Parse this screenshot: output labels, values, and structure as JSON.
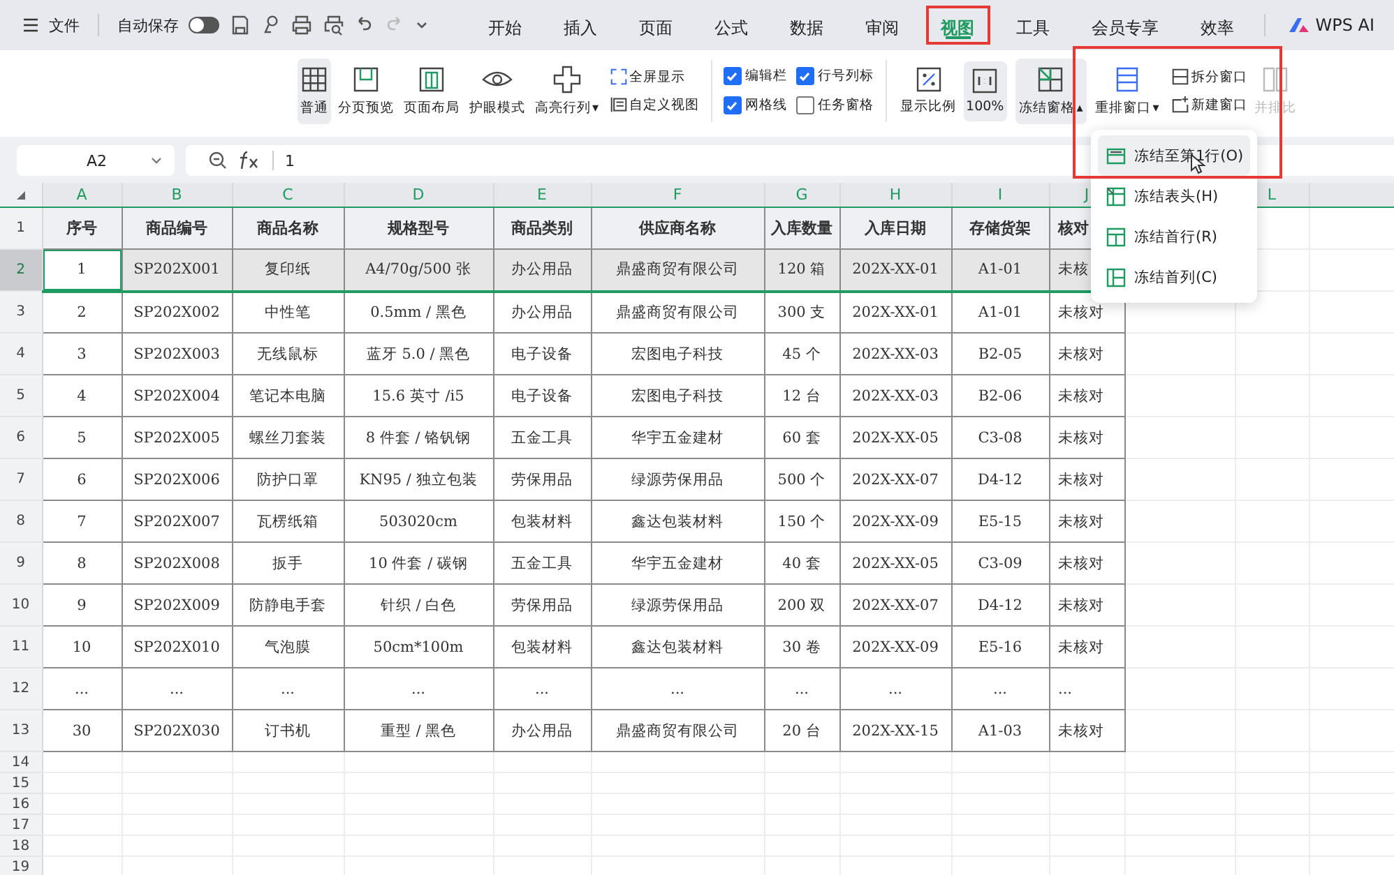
{
  "title_bar": {
    "menu_label": "文件",
    "autosave_label": "自动保存",
    "autosave_on": false
  },
  "tabs": [
    {
      "label": "开始",
      "selected": false,
      "outlined": false
    },
    {
      "label": "插入",
      "selected": false,
      "outlined": false
    },
    {
      "label": "页面",
      "selected": false,
      "outlined": false
    },
    {
      "label": "公式",
      "selected": false,
      "outlined": false
    },
    {
      "label": "数据",
      "selected": false,
      "outlined": false
    },
    {
      "label": "审阅",
      "selected": false,
      "outlined": false
    },
    {
      "label": "视图",
      "selected": true,
      "outlined": true
    },
    {
      "label": "工具",
      "selected": false,
      "outlined": false
    },
    {
      "label": "会员专享",
      "selected": false,
      "outlined": false
    },
    {
      "label": "效率",
      "selected": false,
      "outlined": false
    }
  ],
  "ai_label": "WPS AI",
  "ribbon": {
    "view_buttons": [
      {
        "label": "普通",
        "kind": "grid",
        "selected": true
      },
      {
        "label": "分页预览",
        "kind": "pagebreak",
        "selected": false
      },
      {
        "label": "页面布局",
        "kind": "layout",
        "selected": false
      },
      {
        "label": "护眼模式",
        "kind": "eye",
        "selected": false
      },
      {
        "label": "高亮行列",
        "kind": "cross",
        "selected": false,
        "caret": "▾"
      }
    ],
    "small_buttons": [
      {
        "label": "全屏显示",
        "kind": "fullscreen"
      },
      {
        "label": "自定义视图",
        "kind": "custom"
      }
    ],
    "checkboxes": [
      {
        "label": "编辑栏",
        "checked": true
      },
      {
        "label": "行号列标",
        "checked": true
      },
      {
        "label": "网格线",
        "checked": true
      },
      {
        "label": "任务窗格",
        "checked": false
      }
    ],
    "zoom_buttons": [
      {
        "label": "显示比例",
        "kind": "percent",
        "selected": false
      },
      {
        "label": "100%",
        "kind": "onetoone",
        "selected": true
      }
    ],
    "window_buttons": [
      {
        "label": "冻结窗格",
        "kind": "freeze",
        "caret": "▴",
        "selected": true
      },
      {
        "label": "重排窗口",
        "kind": "arrange",
        "caret": "▾",
        "selected": false
      }
    ],
    "window_small": [
      {
        "label": "拆分窗口",
        "kind": "split"
      },
      {
        "label": "新建窗口",
        "kind": "new"
      }
    ],
    "compare": {
      "label": "并排比",
      "disabled": true
    }
  },
  "freeze_outlined": true,
  "freeze_menu": [
    {
      "label": "冻结至第1行(O)",
      "kind": "rows",
      "selected": true
    },
    {
      "label": "冻结表头(H)",
      "kind": "header",
      "selected": false
    },
    {
      "label": "冻结首行(R)",
      "kind": "firstrow",
      "selected": false
    },
    {
      "label": "冻结首列(C)",
      "kind": "firstcol",
      "selected": false
    }
  ],
  "name_box": "A2",
  "formula": "1",
  "column_letters": [
    "A",
    "B",
    "C",
    "D",
    "E",
    "F",
    "G",
    "H",
    "I",
    "J"
  ],
  "extra_column_letter": "L",
  "rows": [
    {
      "number": "1",
      "selected": false,
      "cells": [
        "序号",
        "商品编号",
        "商品名称",
        "规格型号",
        "商品类别",
        "供应商名称",
        "入库数量",
        "入库日期",
        "存储货架",
        "核对"
      ]
    },
    {
      "number": "2",
      "selected": true,
      "cells": [
        "1",
        "SP202X001",
        "复印纸",
        "A4/70g/500 张",
        "办公用品",
        "鼎盛商贸有限公司",
        "120 箱",
        "202X-XX-01",
        "A1-01",
        "未核"
      ]
    },
    {
      "number": "3",
      "selected": false,
      "cells": [
        "2",
        "SP202X002",
        "中性笔",
        "0.5mm / 黑色",
        "办公用品",
        "鼎盛商贸有限公司",
        "300 支",
        "202X-XX-01",
        "A1-01",
        "未核对"
      ]
    },
    {
      "number": "4",
      "selected": false,
      "cells": [
        "3",
        "SP202X003",
        "无线鼠标",
        "蓝牙 5.0 / 黑色",
        "电子设备",
        "宏图电子科技",
        "45 个",
        "202X-XX-03",
        "B2-05",
        "未核对"
      ]
    },
    {
      "number": "5",
      "selected": false,
      "cells": [
        "4",
        "SP202X004",
        "笔记本电脑",
        "15.6 英寸 /i5",
        "电子设备",
        "宏图电子科技",
        "12 台",
        "202X-XX-03",
        "B2-06",
        "未核对"
      ]
    },
    {
      "number": "6",
      "selected": false,
      "cells": [
        "5",
        "SP202X005",
        "螺丝刀套装",
        "8 件套 / 铬钒钢",
        "五金工具",
        "华宇五金建材",
        "60 套",
        "202X-XX-05",
        "C3-08",
        "未核对"
      ]
    },
    {
      "number": "7",
      "selected": false,
      "cells": [
        "6",
        "SP202X006",
        "防护口罩",
        "KN95 / 独立包装",
        "劳保用品",
        "绿源劳保用品",
        "500 个",
        "202X-XX-07",
        "D4-12",
        "未核对"
      ]
    },
    {
      "number": "8",
      "selected": false,
      "cells": [
        "7",
        "SP202X007",
        "瓦楞纸箱",
        "503020cm",
        "包装材料",
        "鑫达包装材料",
        "150 个",
        "202X-XX-09",
        "E5-15",
        "未核对"
      ]
    },
    {
      "number": "9",
      "selected": false,
      "cells": [
        "8",
        "SP202X008",
        "扳手",
        "10 件套 / 碳钢",
        "五金工具",
        "华宇五金建材",
        "40 套",
        "202X-XX-05",
        "C3-09",
        "未核对"
      ]
    },
    {
      "number": "10",
      "selected": false,
      "cells": [
        "9",
        "SP202X009",
        "防静电手套",
        "针织 / 白色",
        "劳保用品",
        "绿源劳保用品",
        "200 双",
        "202X-XX-07",
        "D4-12",
        "未核对"
      ]
    },
    {
      "number": "11",
      "selected": false,
      "cells": [
        "10",
        "SP202X010",
        "气泡膜",
        "50cm*100m",
        "包装材料",
        "鑫达包装材料",
        "30 卷",
        "202X-XX-09",
        "E5-16",
        "未核对"
      ]
    },
    {
      "number": "12",
      "selected": false,
      "cells": [
        "...",
        "...",
        "...",
        "...",
        "...",
        "...",
        "...",
        "...",
        "...",
        "..."
      ]
    },
    {
      "number": "13",
      "selected": false,
      "cells": [
        "30",
        "SP202X030",
        "订书机",
        "重型 / 黑色",
        "办公用品",
        "鼎盛商贸有限公司",
        "20 台",
        "202X-XX-15",
        "A1-03",
        "未核对"
      ]
    }
  ],
  "empty_row_numbers": [
    "14",
    "15",
    "16",
    "17",
    "18",
    "19"
  ]
}
